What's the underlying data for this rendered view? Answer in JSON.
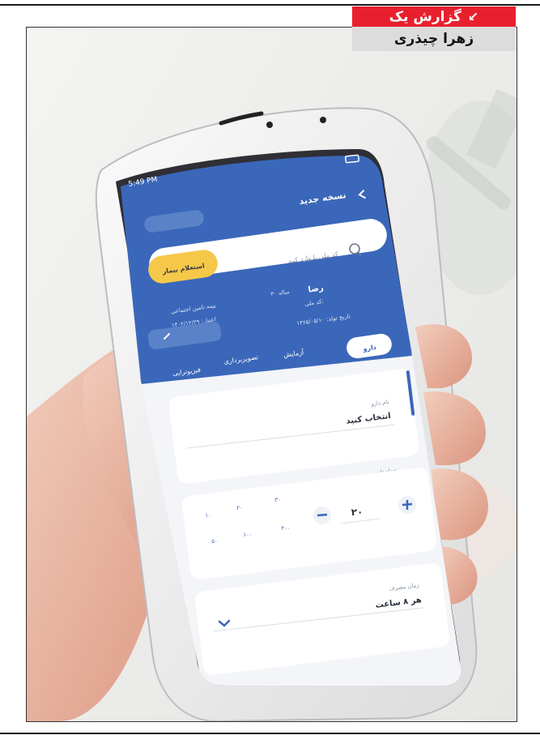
{
  "header": {
    "category": "گزارش یک",
    "author": "زهرا چیذری"
  },
  "phone": {
    "status_time": "5:49 PM",
    "screen_title": "نسخه جدید",
    "search_placeholder": "کد ملی یا وارد کنید",
    "inquiry_button": "استعلام بیمار",
    "patient_name": "رضا",
    "patient_age": "۳۰ ساله",
    "national_code_label": "کد ملی:",
    "birth_date": "تاریخ تولد: ۱۳۶۵/۰۵/۱۰",
    "insurance": "بیمه تامین اجتماعی",
    "insurance_code": "اعتبار: ۱۴۰۲/۱۲/۲۹",
    "tabs": [
      "دارو",
      "آزمایش",
      "تصویربرداری",
      "فیزیوتراپی"
    ],
    "drug_name_label": "نام دارو",
    "drug_name_value": "انتخاب کنید",
    "drug_count_label": "تعداد دارو",
    "count_value": "۲۰",
    "count_presets": [
      "۱۰",
      "۲۰",
      "۳۰",
      "۵۰",
      "۱۰۰",
      "۲۰۰"
    ],
    "usage_label": "زمان مصرف",
    "usage_value": "هر ۸ ساعت"
  },
  "colors": {
    "header_red": "#e8202e",
    "app_blue": "#3a67b9",
    "button_yellow": "#f5c84a"
  }
}
